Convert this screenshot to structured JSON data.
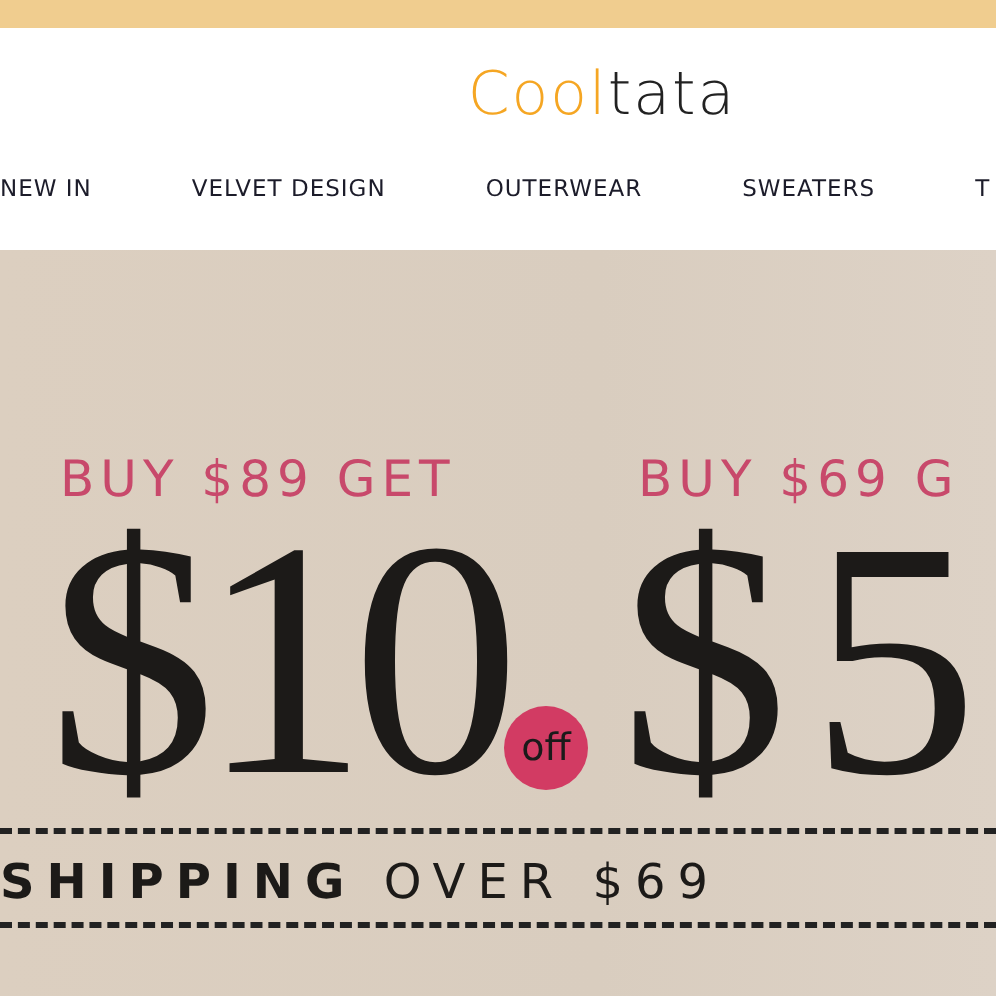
{
  "logo": {
    "first": "Cool",
    "second": "tata"
  },
  "nav": [
    {
      "label": "NEW IN"
    },
    {
      "label": "VELVET DESIGN"
    },
    {
      "label": "OUTERWEAR"
    },
    {
      "label": "SWEATERS"
    },
    {
      "label": "T"
    }
  ],
  "banner": {
    "offers": [
      {
        "headline": "BUY $89 GET",
        "amount": "$10",
        "badge": "off"
      },
      {
        "headline": "BUY $69 G",
        "amount": "$ 5"
      }
    ],
    "shipping": "**SHIPPING** OVER $69"
  }
}
